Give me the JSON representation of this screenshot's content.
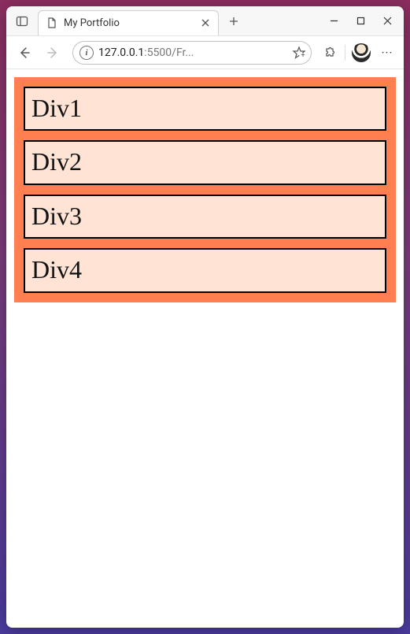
{
  "tab": {
    "title": "My Portfolio"
  },
  "address": {
    "host": "127.0.0.1",
    "port": ":5500",
    "path": "/Fr..."
  },
  "page": {
    "divs": [
      {
        "label": "Div1"
      },
      {
        "label": "Div2"
      },
      {
        "label": "Div3"
      },
      {
        "label": "Div4"
      }
    ]
  }
}
